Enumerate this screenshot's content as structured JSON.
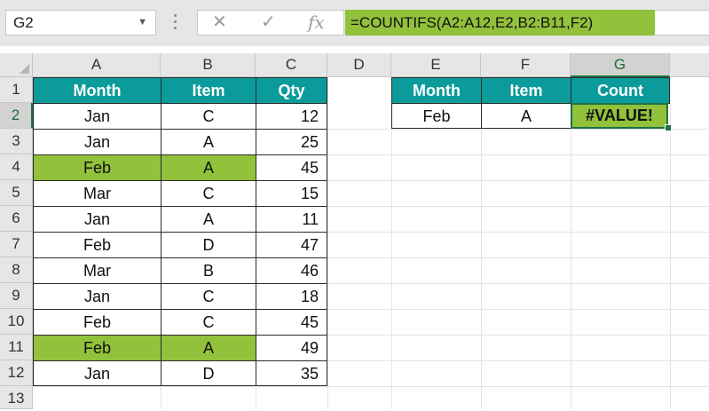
{
  "formula_bar": {
    "name_box": "G2",
    "cancel_icon": "✕",
    "enter_icon": "✓",
    "fx_label": "fx",
    "formula": "=COUNTIFS(A2:A12,E2,B2:B11,F2)"
  },
  "columns": [
    "A",
    "B",
    "C",
    "D",
    "E",
    "F",
    "G"
  ],
  "rows": [
    "1",
    "2",
    "3",
    "4",
    "5",
    "6",
    "7",
    "8",
    "9",
    "10",
    "11",
    "12",
    "13"
  ],
  "selected_cell": "G2",
  "colors": {
    "header_teal": "#0c9b9b",
    "highlight_green": "#92c13b",
    "selection_green": "#1e7145"
  },
  "table": {
    "headers": [
      "Month",
      "Item",
      "Qty"
    ],
    "rows": [
      {
        "month": "Jan",
        "item": "C",
        "qty": "12"
      },
      {
        "month": "Jan",
        "item": "A",
        "qty": "25"
      },
      {
        "month": "Feb",
        "item": "A",
        "qty": "45"
      },
      {
        "month": "Mar",
        "item": "C",
        "qty": "15"
      },
      {
        "month": "Jan",
        "item": "A",
        "qty": "11"
      },
      {
        "month": "Feb",
        "item": "D",
        "qty": "47"
      },
      {
        "month": "Mar",
        "item": "B",
        "qty": "46"
      },
      {
        "month": "Jan",
        "item": "C",
        "qty": "18"
      },
      {
        "month": "Feb",
        "item": "C",
        "qty": "45"
      },
      {
        "month": "Feb",
        "item": "A",
        "qty": "49"
      },
      {
        "month": "Jan",
        "item": "D",
        "qty": "35"
      }
    ],
    "highlighted_rows": [
      4,
      11
    ]
  },
  "criteria": {
    "headers": [
      "Month",
      "Item",
      "Count"
    ],
    "month": "Feb",
    "item": "A",
    "count": "#VALUE!"
  }
}
